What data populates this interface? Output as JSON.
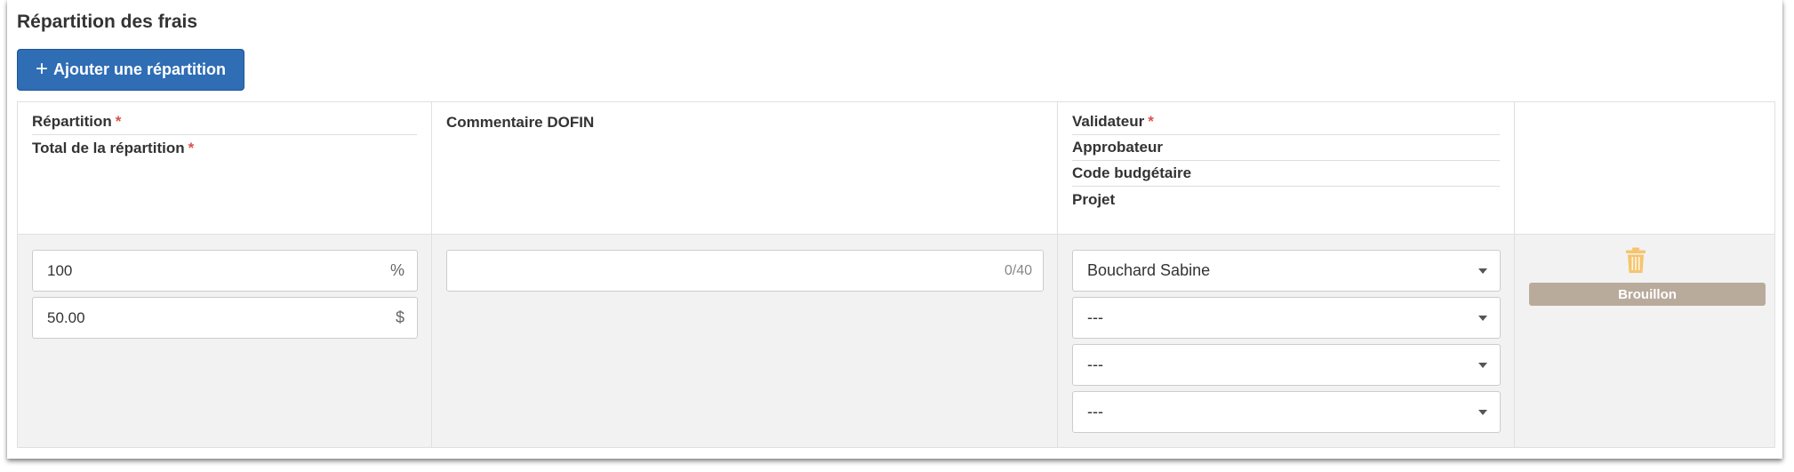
{
  "section": {
    "title": "Répartition des frais"
  },
  "add_button": {
    "icon": "plus-icon",
    "label": "Ajouter une répartition"
  },
  "table": {
    "headers": {
      "col1": [
        "Répartition",
        "Total de la répartition"
      ],
      "col2": "Commentaire DOFIN",
      "col3": [
        "Validateur",
        "Approbateur",
        "Code budgétaire",
        "Projet"
      ],
      "required_marker": "*"
    },
    "row": {
      "percentage": {
        "value": "100",
        "unit": "%"
      },
      "total": {
        "value": "50.00",
        "unit": "$"
      },
      "comment": {
        "value": "",
        "counter": "0/40"
      },
      "validateur": "Bouchard Sabine",
      "approbateur": "---",
      "code_budgetaire": "---",
      "projet": "---",
      "delete_icon": "trash-icon",
      "status": "Brouillon"
    }
  },
  "colors": {
    "primary_button": "#2f6db5",
    "required": "#d9534f",
    "trash_icon": "#f5c56e",
    "status_badge": "#b9ab9c",
    "row_background": "#f2f2f2"
  }
}
